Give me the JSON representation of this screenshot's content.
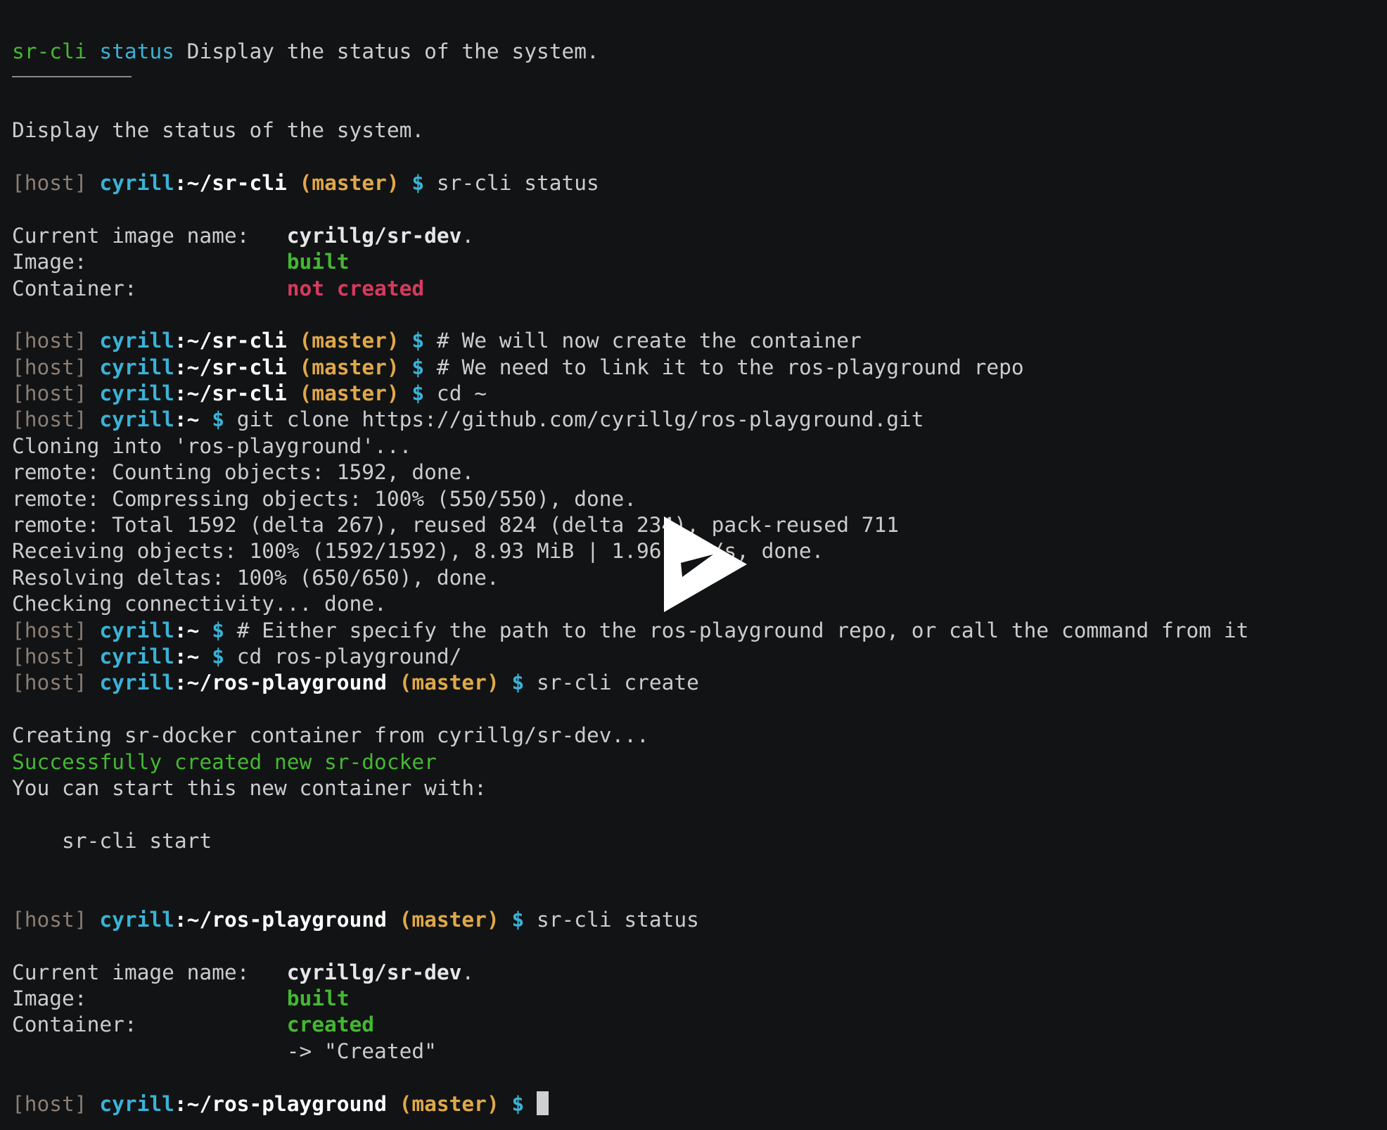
{
  "colors": {
    "background": "#121314",
    "text": "#cccccc",
    "host": "#8a7e75",
    "user": "#3ab2d7",
    "path": "#ffffff",
    "branch": "#e0a84a",
    "prompt": "#3ab2d7",
    "success": "#44b833",
    "error": "#d63a5f"
  },
  "overlay": {
    "icon": "asciinema-play-icon"
  },
  "lines": [
    {
      "type": "segments",
      "parts": [
        {
          "text": "sr-cli",
          "c": "green"
        },
        {
          "text": " "
        },
        {
          "text": "status",
          "c": "cyan"
        },
        {
          "text": " Display the status of the system."
        }
      ]
    },
    {
      "type": "rule"
    },
    {
      "type": "blank"
    },
    {
      "type": "text",
      "text": "Display the status of the system."
    },
    {
      "type": "blank"
    },
    {
      "type": "prompt",
      "host": "[host]",
      "user": "cyrill",
      "path": ":~/sr-cli",
      "branch": " (master)",
      "sign": " $",
      "cmd": " sr-cli status"
    },
    {
      "type": "blank"
    },
    {
      "type": "segments",
      "parts": [
        {
          "text": "Current image name:   "
        },
        {
          "text": "cyrillg/sr-dev",
          "c": "white",
          "b": true
        },
        {
          "text": "."
        }
      ]
    },
    {
      "type": "segments",
      "parts": [
        {
          "text": "Image:                "
        },
        {
          "text": "built",
          "c": "green",
          "b": true
        }
      ]
    },
    {
      "type": "segments",
      "parts": [
        {
          "text": "Container:            "
        },
        {
          "text": "not created",
          "c": "red",
          "b": true
        }
      ]
    },
    {
      "type": "blank"
    },
    {
      "type": "prompt",
      "host": "[host]",
      "user": "cyrill",
      "path": ":~/sr-cli",
      "branch": " (master)",
      "sign": " $",
      "cmd": " # We will now create the container"
    },
    {
      "type": "prompt",
      "host": "[host]",
      "user": "cyrill",
      "path": ":~/sr-cli",
      "branch": " (master)",
      "sign": " $",
      "cmd": " # We need to link it to the ros-playground repo"
    },
    {
      "type": "prompt",
      "host": "[host]",
      "user": "cyrill",
      "path": ":~/sr-cli",
      "branch": " (master)",
      "sign": " $",
      "cmd": " cd ~"
    },
    {
      "type": "prompt",
      "host": "[host]",
      "user": "cyrill",
      "path": ":~",
      "branch": "",
      "sign": " $",
      "cmd": " git clone https://github.com/cyrillg/ros-playground.git"
    },
    {
      "type": "text",
      "text": "Cloning into 'ros-playground'..."
    },
    {
      "type": "text",
      "text": "remote: Counting objects: 1592, done."
    },
    {
      "type": "text",
      "text": "remote: Compressing objects: 100% (550/550), done."
    },
    {
      "type": "text",
      "text": "remote: Total 1592 (delta 267), reused 824 (delta 234), pack-reused 711"
    },
    {
      "type": "text",
      "text": "Receiving objects: 100% (1592/1592), 8.93 MiB | 1.96 MiB/s, done."
    },
    {
      "type": "text",
      "text": "Resolving deltas: 100% (650/650), done."
    },
    {
      "type": "text",
      "text": "Checking connectivity... done."
    },
    {
      "type": "prompt",
      "host": "[host]",
      "user": "cyrill",
      "path": ":~",
      "branch": "",
      "sign": " $",
      "cmd": " # Either specify the path to the ros-playground repo, or call the command from it"
    },
    {
      "type": "prompt",
      "host": "[host]",
      "user": "cyrill",
      "path": ":~",
      "branch": "",
      "sign": " $",
      "cmd": " cd ros-playground/"
    },
    {
      "type": "prompt",
      "host": "[host]",
      "user": "cyrill",
      "path": ":~/ros-playground",
      "branch": " (master)",
      "sign": " $",
      "cmd": " sr-cli create"
    },
    {
      "type": "blank"
    },
    {
      "type": "text",
      "text": "Creating sr-docker container from cyrillg/sr-dev..."
    },
    {
      "type": "segments",
      "parts": [
        {
          "text": "Successfully created new sr-docker",
          "c": "green"
        }
      ]
    },
    {
      "type": "text",
      "text": "You can start this new container with:"
    },
    {
      "type": "blank"
    },
    {
      "type": "text",
      "text": "    sr-cli start"
    },
    {
      "type": "blank"
    },
    {
      "type": "blank"
    },
    {
      "type": "prompt",
      "host": "[host]",
      "user": "cyrill",
      "path": ":~/ros-playground",
      "branch": " (master)",
      "sign": " $",
      "cmd": " sr-cli status"
    },
    {
      "type": "blank"
    },
    {
      "type": "segments",
      "parts": [
        {
          "text": "Current image name:   "
        },
        {
          "text": "cyrillg/sr-dev",
          "c": "white",
          "b": true
        },
        {
          "text": "."
        }
      ]
    },
    {
      "type": "segments",
      "parts": [
        {
          "text": "Image:                "
        },
        {
          "text": "built",
          "c": "green",
          "b": true
        }
      ]
    },
    {
      "type": "segments",
      "parts": [
        {
          "text": "Container:            "
        },
        {
          "text": "created",
          "c": "green",
          "b": true
        }
      ]
    },
    {
      "type": "text",
      "text": "                      -> \"Created\""
    },
    {
      "type": "blank"
    },
    {
      "type": "prompt",
      "host": "[host]",
      "user": "cyrill",
      "path": ":~/ros-playground",
      "branch": " (master)",
      "sign": " $",
      "cmd": " ",
      "cursor": true
    }
  ]
}
